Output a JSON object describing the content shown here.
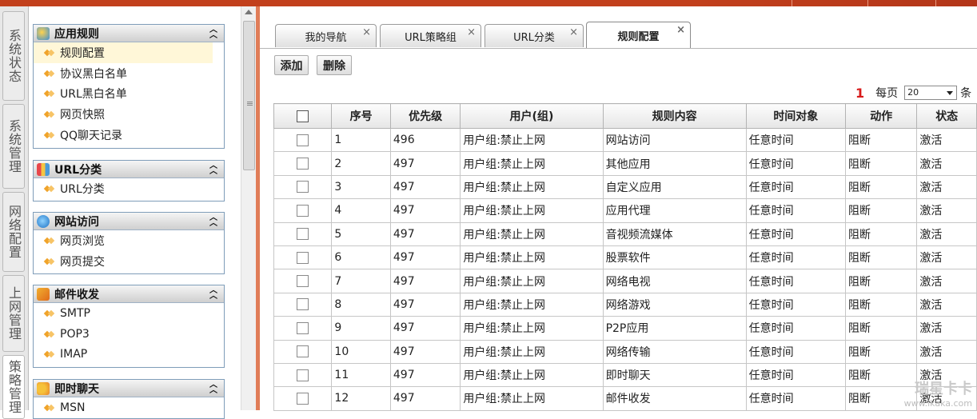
{
  "sidebar_tabs": [
    "系统状态",
    "系统管理",
    "网络配置",
    "上网管理",
    "策略管理"
  ],
  "menu": {
    "groups": [
      {
        "title": "应用规则",
        "icon": "app-rules-icon",
        "items": [
          "规则配置",
          "协议黑白名单",
          "URL黑白名单",
          "网页快照",
          "QQ聊天记录"
        ]
      },
      {
        "title": "URL分类",
        "icon": "url-category-icon",
        "items": [
          "URL分类"
        ]
      },
      {
        "title": "网站访问",
        "icon": "web-access-icon",
        "items": [
          "网页浏览",
          "网页提交"
        ]
      },
      {
        "title": "邮件收发",
        "icon": "mail-icon",
        "items": [
          "SMTP",
          "POP3",
          "IMAP"
        ]
      },
      {
        "title": "即时聊天",
        "icon": "chat-icon",
        "items": [
          "MSN"
        ]
      }
    ],
    "active_item": "规则配置"
  },
  "tabs": [
    {
      "label": "我的导航",
      "close": "×"
    },
    {
      "label": "URL策略组",
      "close": "×"
    },
    {
      "label": "URL分类",
      "close": "×"
    },
    {
      "label": "规则配置",
      "close": "×",
      "active": true
    }
  ],
  "toolbar": {
    "add_label": "添加",
    "delete_label": "删除"
  },
  "pager": {
    "page": "1",
    "per_page_label": "每页",
    "per_page_value": "20",
    "unit_label": "条"
  },
  "table": {
    "headers": [
      "序号",
      "优先级",
      "用户(组)",
      "规则内容",
      "时间对象",
      "动作",
      "状态"
    ],
    "rows": [
      [
        "1",
        "496",
        "用户组:禁止上网",
        "网站访问",
        "任意时间",
        "阻断",
        "激活"
      ],
      [
        "2",
        "497",
        "用户组:禁止上网",
        "其他应用",
        "任意时间",
        "阻断",
        "激活"
      ],
      [
        "3",
        "497",
        "用户组:禁止上网",
        "自定义应用",
        "任意时间",
        "阻断",
        "激活"
      ],
      [
        "4",
        "497",
        "用户组:禁止上网",
        "应用代理",
        "任意时间",
        "阻断",
        "激活"
      ],
      [
        "5",
        "497",
        "用户组:禁止上网",
        "音视频流媒体",
        "任意时间",
        "阻断",
        "激活"
      ],
      [
        "6",
        "497",
        "用户组:禁止上网",
        "股票软件",
        "任意时间",
        "阻断",
        "激活"
      ],
      [
        "7",
        "497",
        "用户组:禁止上网",
        "网络电视",
        "任意时间",
        "阻断",
        "激活"
      ],
      [
        "8",
        "497",
        "用户组:禁止上网",
        "网络游戏",
        "任意时间",
        "阻断",
        "激活"
      ],
      [
        "9",
        "497",
        "用户组:禁止上网",
        "P2P应用",
        "任意时间",
        "阻断",
        "激活"
      ],
      [
        "10",
        "497",
        "用户组:禁止上网",
        "网络传输",
        "任意时间",
        "阻断",
        "激活"
      ],
      [
        "11",
        "497",
        "用户组:禁止上网",
        "即时聊天",
        "任意时间",
        "阻断",
        "激活"
      ],
      [
        "12",
        "497",
        "用户组:禁止上网",
        "邮件收发",
        "任意时间",
        "阻断",
        "激活"
      ]
    ]
  },
  "watermark": {
    "line1": "瑞星卡卡",
    "line2": "www.ikaka.com"
  },
  "colors": {
    "topbar": "#c2401c",
    "splitter": "#e07d58",
    "page_number": "#d81b1b",
    "group_border": "#7f9db9"
  }
}
